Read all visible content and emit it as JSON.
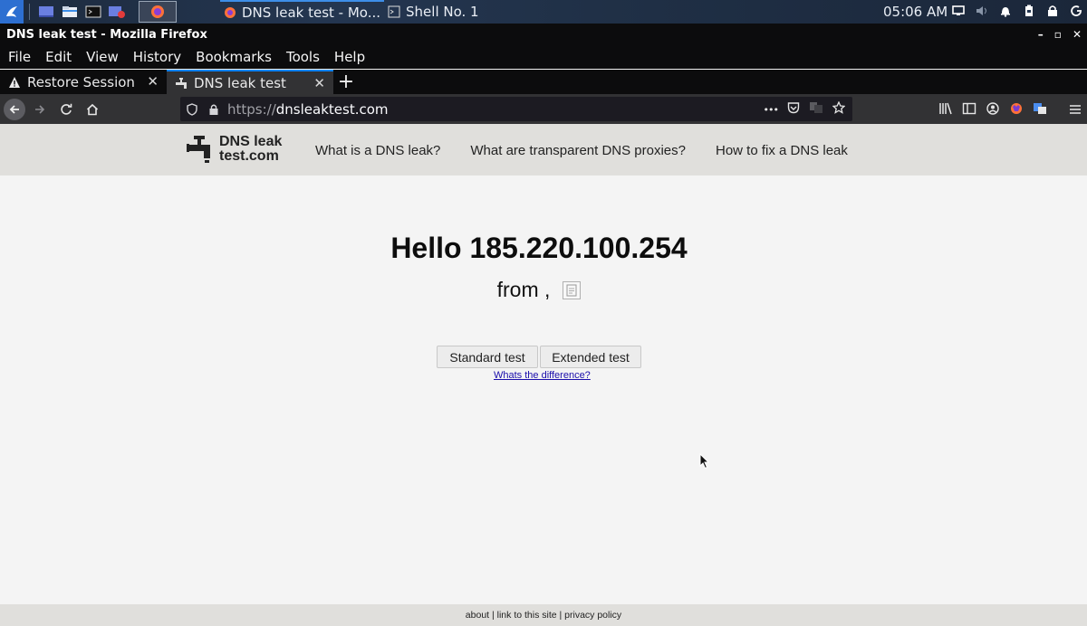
{
  "taskbar": {
    "windows": [
      {
        "label": "DNS leak test - Mo..."
      },
      {
        "label": "Shell No. 1"
      }
    ],
    "clock": "05:06 AM"
  },
  "firefox": {
    "window_title": "DNS leak test - Mozilla Firefox",
    "window_controls": [
      "–",
      "▫",
      "✕"
    ],
    "menu": [
      "File",
      "Edit",
      "View",
      "History",
      "Bookmarks",
      "Tools",
      "Help"
    ],
    "tabs": [
      {
        "label": "Restore Session",
        "icon": "warning-icon",
        "selected": false
      },
      {
        "label": "DNS leak test",
        "icon": "tap-icon",
        "selected": true
      }
    ],
    "url": {
      "scheme": "https://",
      "host": "dnsleaktest.com"
    },
    "tab_close_glyph": "✕",
    "new_tab_glyph": "+",
    "url_more_glyph": "•••"
  },
  "site": {
    "logo_line1": "DNS leak",
    "logo_line2": "test.com",
    "nav": [
      "What is a DNS leak?",
      "What are transparent DNS proxies?",
      "How to fix a DNS leak"
    ],
    "hello": "Hello 185.220.100.254",
    "from": "from ,",
    "buttons": {
      "standard": "Standard test",
      "extended": "Extended test"
    },
    "diff_link": "Whats the difference?",
    "footer": {
      "about": "about",
      "sep": " | ",
      "link": "link to this site",
      "privacy": "privacy policy"
    }
  },
  "colors": {
    "accent": "#0a84ff",
    "header_bg": "#e0dfdc",
    "page_bg": "#f4f4f4"
  }
}
